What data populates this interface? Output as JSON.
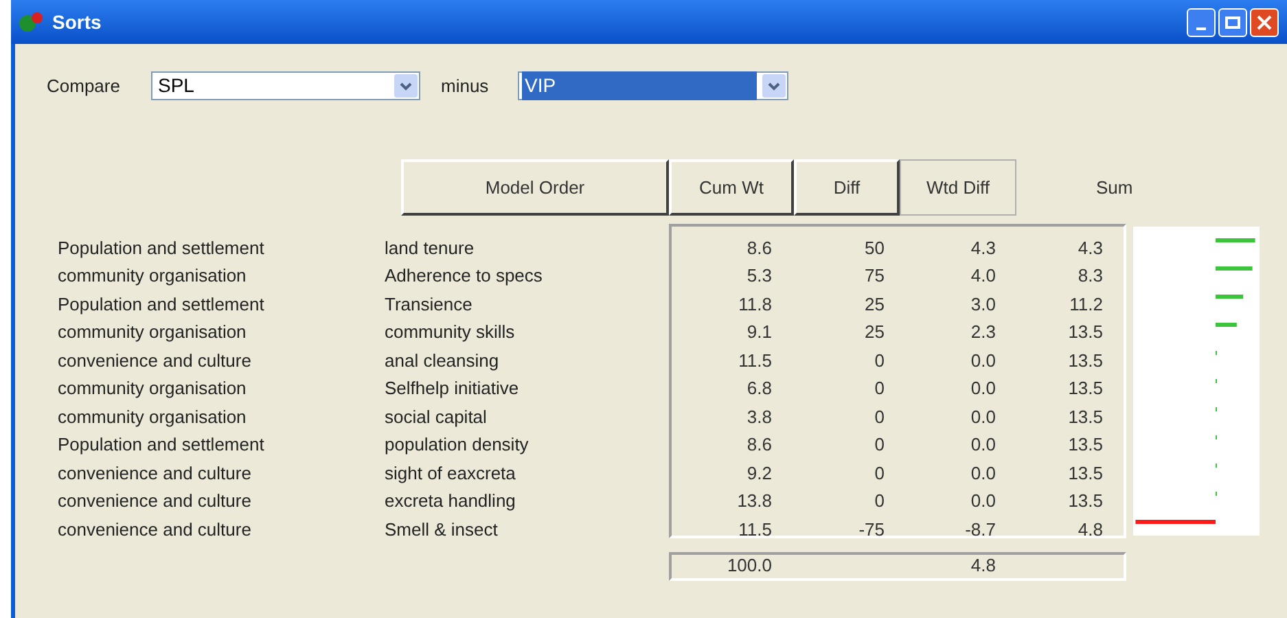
{
  "window": {
    "title": "Sorts"
  },
  "compare": {
    "label": "Compare",
    "value": "SPL"
  },
  "minus": {
    "label": "minus",
    "value": "VIP",
    "selected": true
  },
  "sort_buttons": [
    {
      "label": "Model Order",
      "selected": false
    },
    {
      "label": "Cum Wt",
      "selected": false
    },
    {
      "label": "Diff",
      "selected": false
    },
    {
      "label": "Wtd Diff",
      "selected": true
    }
  ],
  "sum_heading": "Sum",
  "rows": [
    {
      "group": "Population and settlement",
      "name": "land tenure",
      "cum_wt": "8.6",
      "diff": "50",
      "wtd_diff": "4.3",
      "sum": "4.3"
    },
    {
      "group": "community organisation",
      "name": "Adherence to specs",
      "cum_wt": "5.3",
      "diff": "75",
      "wtd_diff": "4.0",
      "sum": "8.3"
    },
    {
      "group": "Population and settlement",
      "name": "Transience",
      "cum_wt": "11.8",
      "diff": "25",
      "wtd_diff": "3.0",
      "sum": "11.2"
    },
    {
      "group": "community organisation",
      "name": "community skills",
      "cum_wt": "9.1",
      "diff": "25",
      "wtd_diff": "2.3",
      "sum": "13.5"
    },
    {
      "group": "convenience and culture",
      "name": "anal cleansing",
      "cum_wt": "11.5",
      "diff": "0",
      "wtd_diff": "0.0",
      "sum": "13.5"
    },
    {
      "group": "community organisation",
      "name": "Selfhelp initiative",
      "cum_wt": "6.8",
      "diff": "0",
      "wtd_diff": "0.0",
      "sum": "13.5"
    },
    {
      "group": "community organisation",
      "name": "social capital",
      "cum_wt": "3.8",
      "diff": "0",
      "wtd_diff": "0.0",
      "sum": "13.5"
    },
    {
      "group": "Population and settlement",
      "name": "population density",
      "cum_wt": "8.6",
      "diff": "0",
      "wtd_diff": "0.0",
      "sum": "13.5"
    },
    {
      "group": "convenience and culture",
      "name": "sight of eaxcreta",
      "cum_wt": "9.2",
      "diff": "0",
      "wtd_diff": "0.0",
      "sum": "13.5"
    },
    {
      "group": "convenience and culture",
      "name": "excreta handling",
      "cum_wt": "13.8",
      "diff": "0",
      "wtd_diff": "0.0",
      "sum": "13.5"
    },
    {
      "group": "convenience and culture",
      "name": "Smell & insect",
      "cum_wt": "11.5",
      "diff": "-75",
      "wtd_diff": "-8.7",
      "sum": "4.8"
    }
  ],
  "totals": {
    "cum_wt": "100.0",
    "wtd_diff": "4.8"
  }
}
